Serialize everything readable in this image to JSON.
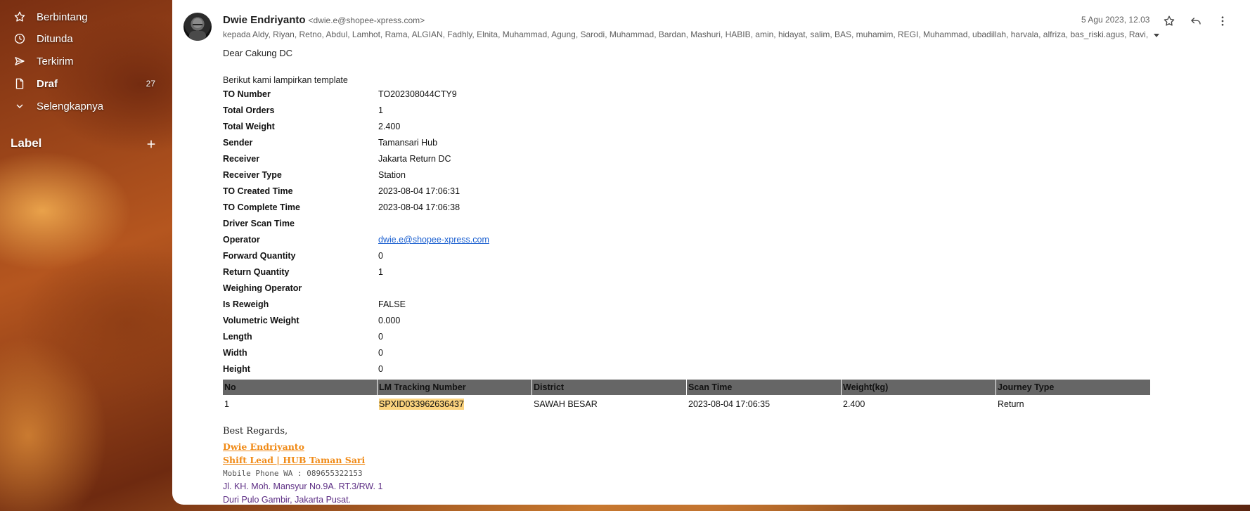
{
  "sidebar": {
    "items": [
      {
        "label": "Berbintang",
        "icon": "star-icon",
        "count": ""
      },
      {
        "label": "Ditunda",
        "icon": "clock-icon",
        "count": ""
      },
      {
        "label": "Terkirim",
        "icon": "send-icon",
        "count": ""
      },
      {
        "label": "Draf",
        "icon": "draft-icon",
        "count": "27"
      },
      {
        "label": "Selengkapnya",
        "icon": "chevron-down-icon",
        "count": ""
      }
    ],
    "label_heading": "Label"
  },
  "message": {
    "sender_name": "Dwie Endriyanto",
    "sender_email": "<dwie.e@shopee-xpress.com>",
    "date": "5 Agu 2023, 12.03",
    "recipients": "kepada Aldy, Riyan, Retno, Abdul, Lamhot, Rama, ALGIAN, Fadhly, Elnita, Muhammad, Agung, Sarodi, Muhammad, Bardan, Mashuri, HABIB, amin, hidayat, salim, BAS, muhamim, REGI, Muhammad, ubadillah, harvala, alfriza, bas_riski.agus, Ravi, G",
    "greeting": "Dear Cakung DC",
    "intro": "Berikut kami lampirkan template"
  },
  "fields": [
    {
      "key": "TO Number",
      "value": "TO202308044CTY9"
    },
    {
      "key": "Total Orders",
      "value": "1"
    },
    {
      "key": "Total Weight",
      "value": "2.400"
    },
    {
      "key": "Sender",
      "value": "Tamansari Hub"
    },
    {
      "key": "Receiver",
      "value": "Jakarta Return DC"
    },
    {
      "key": "Receiver Type",
      "value": "Station"
    },
    {
      "key": "TO Created Time",
      "value": "2023-08-04 17:06:31"
    },
    {
      "key": "TO Complete Time",
      "value": "2023-08-04 17:06:38"
    },
    {
      "key": "Driver Scan Time",
      "value": ""
    },
    {
      "key": "Operator",
      "value": "dwie.e@shopee-xpress.com"
    },
    {
      "key": "Forward Quantity",
      "value": "0"
    },
    {
      "key": "Return Quantity",
      "value": "1"
    },
    {
      "key": "Weighing Operator",
      "value": ""
    },
    {
      "key": "Is Reweigh",
      "value": "FALSE"
    },
    {
      "key": "Volumetric Weight",
      "value": "0.000"
    },
    {
      "key": "Length",
      "value": "0"
    },
    {
      "key": "Width",
      "value": "0"
    },
    {
      "key": "Height",
      "value": "0"
    }
  ],
  "table": {
    "headers": [
      "No",
      "LM Tracking Number",
      "District",
      "Scan Time",
      "Weight(kg)",
      "Journey Type"
    ],
    "rows": [
      [
        "1",
        "SPXID033962636437",
        "SAWAH BESAR",
        "2023-08-04 17:06:35",
        "2.400",
        "Return"
      ]
    ]
  },
  "signature": {
    "regards": "Best Regards,",
    "name": "Dwie Endriyanto",
    "title": "Shift Lead | HUB Taman Sari",
    "phone": "Mobile Phone WA : 089655322153",
    "address1": "Jl. KH. Moh. Mansyur No.9A. RT.3/RW. 1",
    "address2": "Duri Pulo Gambir, Jakarta Pusat."
  },
  "colors": {
    "accent_orange": "#f08a16",
    "table_header": "#666666",
    "highlight": "#fbd37e",
    "link": "#1a5fd0"
  }
}
